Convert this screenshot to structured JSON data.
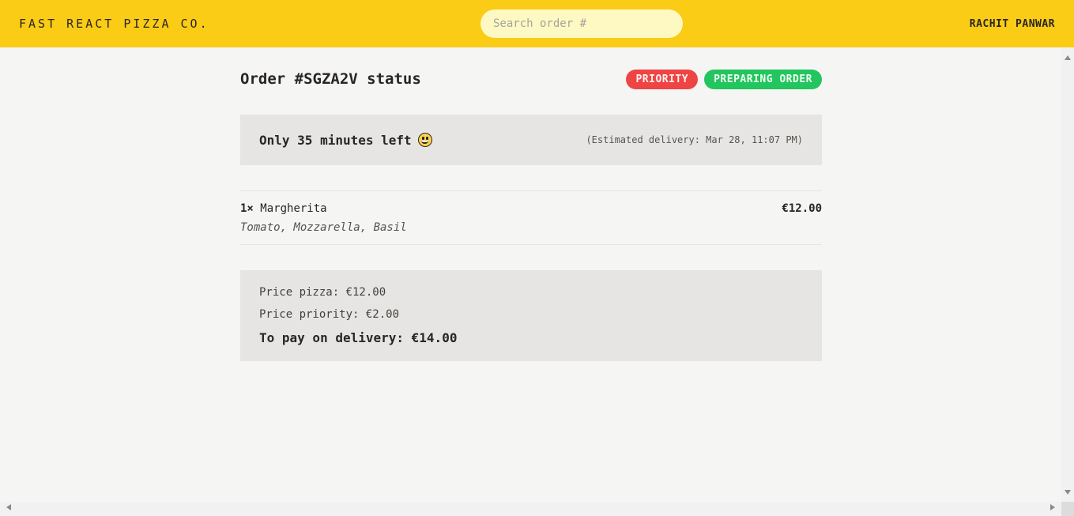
{
  "header": {
    "logo": "Fast React Pizza Co.",
    "search_placeholder": "Search order #",
    "search_value": "",
    "username": "RACHIT PANWAR"
  },
  "order": {
    "title": "Order #SGZA2V status",
    "badges": [
      {
        "label": "Priority",
        "color": "#ef4444"
      },
      {
        "label": "Preparing order",
        "color": "#22c55e"
      }
    ],
    "eta": {
      "text": "Only 35 minutes left",
      "icon": "smiling-face-emoji-icon",
      "estimate": "(Estimated delivery: Mar 28, 11:07 PM)"
    },
    "items": [
      {
        "quantity": "1×",
        "name": "Margherita",
        "price": "€12.00",
        "ingredients": "Tomato, Mozzarella, Basil"
      }
    ],
    "summary": {
      "price_pizza": "Price pizza: €12.00",
      "price_priority": "Price priority: €2.00",
      "total": "To pay on delivery: €14.00"
    }
  },
  "colors": {
    "header_bg": "#facc15",
    "search_bg": "#fef9c3",
    "page_bg": "#f5f5f4",
    "panel_bg": "#e7e5e4"
  }
}
